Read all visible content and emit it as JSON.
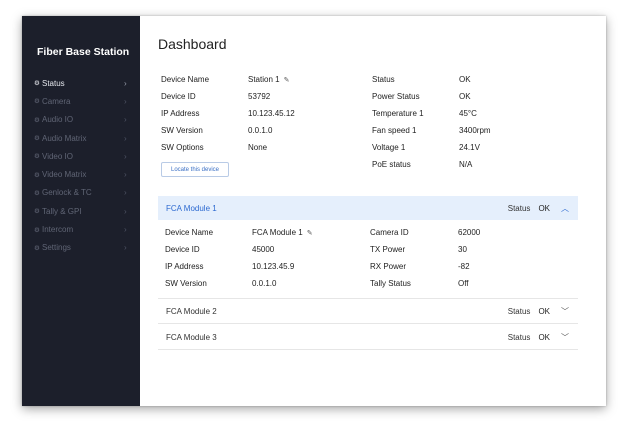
{
  "app_title": "Fiber Base Station",
  "nav": [
    {
      "label": "Status",
      "active": true
    },
    {
      "label": "Camera"
    },
    {
      "label": "Audio IO"
    },
    {
      "label": "Audio Matrix"
    },
    {
      "label": "Video IO"
    },
    {
      "label": "Video Matrix"
    },
    {
      "label": "Genlock & TC"
    },
    {
      "label": "Tally & GPI"
    },
    {
      "label": "Intercom"
    },
    {
      "label": "Settings"
    }
  ],
  "nav_bullet": "⚙",
  "nav_chevron": "›",
  "page_title": "Dashboard",
  "device": {
    "left": [
      {
        "label": "Device Name",
        "value": "Station 1"
      },
      {
        "label": "Device ID",
        "value": "53792"
      },
      {
        "label": "IP Address",
        "value": "10.123.45.12"
      },
      {
        "label": "SW Version",
        "value": "0.0.1.0"
      },
      {
        "label": "SW Options",
        "value": "None"
      }
    ],
    "right": [
      {
        "label": "Status",
        "value": "OK"
      },
      {
        "label": "Power Status",
        "value": "OK"
      },
      {
        "label": "Temperature 1",
        "value": "45°C"
      },
      {
        "label": "Fan speed 1",
        "value": "3400rpm"
      },
      {
        "label": "Voltage 1",
        "value": "24.1V"
      },
      {
        "label": "PoE status",
        "value": "N/A"
      }
    ],
    "locate_button": "Locate this device",
    "edit_icon": "✎"
  },
  "modules": [
    {
      "title": "FCA Module 1",
      "status_label": "Status",
      "status": "OK",
      "expanded": true,
      "chevron": "︿",
      "left": [
        {
          "label": "Device Name",
          "value": "FCA Module 1"
        },
        {
          "label": "Device ID",
          "value": "45000"
        },
        {
          "label": "IP Address",
          "value": "10.123.45.9"
        },
        {
          "label": "SW Version",
          "value": "0.0.1.0"
        }
      ],
      "right": [
        {
          "label": "Camera ID",
          "value": "62000"
        },
        {
          "label": "TX Power",
          "value": "30"
        },
        {
          "label": "RX Power",
          "value": "-82"
        },
        {
          "label": "Tally Status",
          "value": "Off"
        }
      ]
    },
    {
      "title": "FCA Module 2",
      "status_label": "Status",
      "status": "OK",
      "expanded": false,
      "chevron": "﹀"
    },
    {
      "title": "FCA Module 3",
      "status_label": "Status",
      "status": "OK",
      "expanded": false,
      "chevron": "﹀"
    }
  ],
  "colors": {
    "sidebar": "#1c1f2b",
    "accent": "#2d6ad1",
    "expanded_bg": "#e5effc"
  }
}
